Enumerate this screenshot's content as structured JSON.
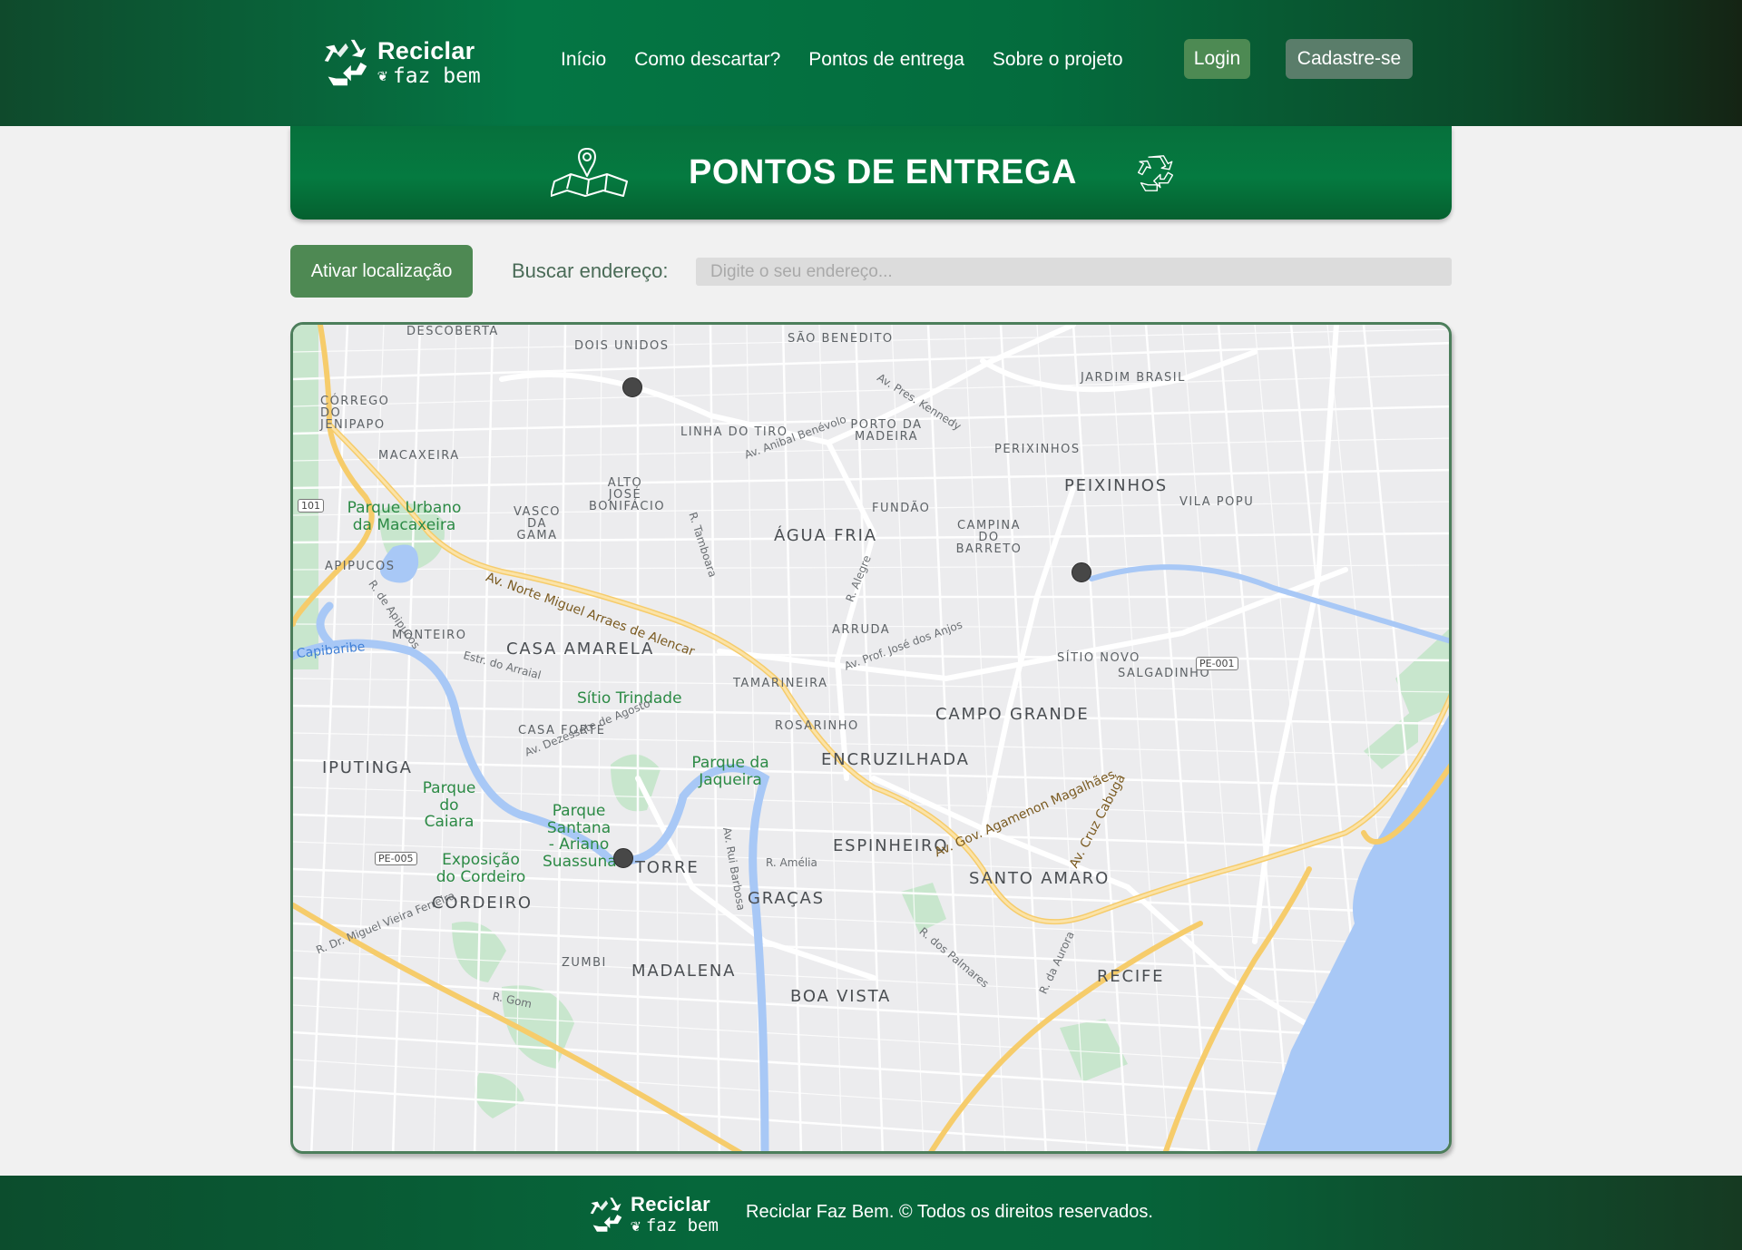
{
  "brand": {
    "name_top": "Reciclar",
    "name_bottom": "faz bem"
  },
  "nav": {
    "items": [
      "Início",
      "Como descartar?",
      "Pontos de entrega",
      "Sobre o projeto"
    ],
    "login": "Login",
    "signup": "Cadastre-se"
  },
  "banner": {
    "title": "PONTOS DE ENTREGA"
  },
  "search": {
    "locate_button": "Ativar localização",
    "label": "Buscar endereço:",
    "placeholder": "Digite o seu endereço..."
  },
  "map": {
    "neighborhoods": [
      "DESCOBERTA",
      "DOIS UNIDOS",
      "SÃO BENEDITO",
      "JARDIM BRASIL",
      "CÓRREGO DO JENIPAPO",
      "LINHA DO TIRO",
      "PORTO DA MADEIRA",
      "PERIXINHOS",
      "MACAXEIRA",
      "ALTO JOSÉ BONIFÁCIO",
      "FUNDÃO",
      "PEIXINHOS",
      "VILA POPU",
      "VASCO DA GAMA",
      "ÁGUA FRIA",
      "CAMPINA DO BARRETO",
      "APIPUCOS",
      "ARRUDA",
      "SÍTIO NOVO",
      "SALGADINHO",
      "MONTEIRO",
      "CASA AMARELA",
      "TAMARINEIRA",
      "CAMPO GRANDE",
      "CASA FORTE",
      "ROSARINHO",
      "ENCRUZILHADA",
      "IPUTINGA",
      "ESPINHEIRO",
      "TORRE",
      "SANTO AMARO",
      "GRAÇAS",
      "CORDEIRO",
      "ZUMBI",
      "MADALENA",
      "BOA VISTA",
      "RECIFE"
    ],
    "parks": [
      "Parque Urbano da Macaxeira",
      "Sítio Trindade",
      "Parque da Jaqueira",
      "Parque do Caiara",
      "Parque Santana - Ariano Suassuna",
      "Exposição do Cordeiro"
    ],
    "streets": [
      "Av. Pres. Kennedy",
      "Av. Anibal Benévolo",
      "R. Tamboara",
      "R. Alegre",
      "Av. Norte Miguel Arraes de Alencar",
      "R. de Apipucos",
      "Estr. do Arraial",
      "Av. Prof. José dos Anjos",
      "Av. Dezessete de Agosto",
      "Av. Rui Barbosa",
      "R. Amélia",
      "Av. Gov. Agamenon Magalhães",
      "Av. Cruz Cabugá",
      "R. dos Palmares",
      "R. da Aurora",
      "R. Dr. Miguel Vieira Ferreira",
      "R. Gom"
    ],
    "water": [
      "Capibaribe"
    ],
    "shields": [
      "101",
      "PE-005",
      "PE-001"
    ],
    "markers": [
      {
        "name": "Ponto de entrega Linha do Tiro"
      },
      {
        "name": "Ponto de entrega Peixinhos"
      },
      {
        "name": "Ponto de entrega Torre"
      }
    ]
  },
  "footer": {
    "copyright": "Reciclar Faz Bem. © Todos os direitos reservados."
  }
}
